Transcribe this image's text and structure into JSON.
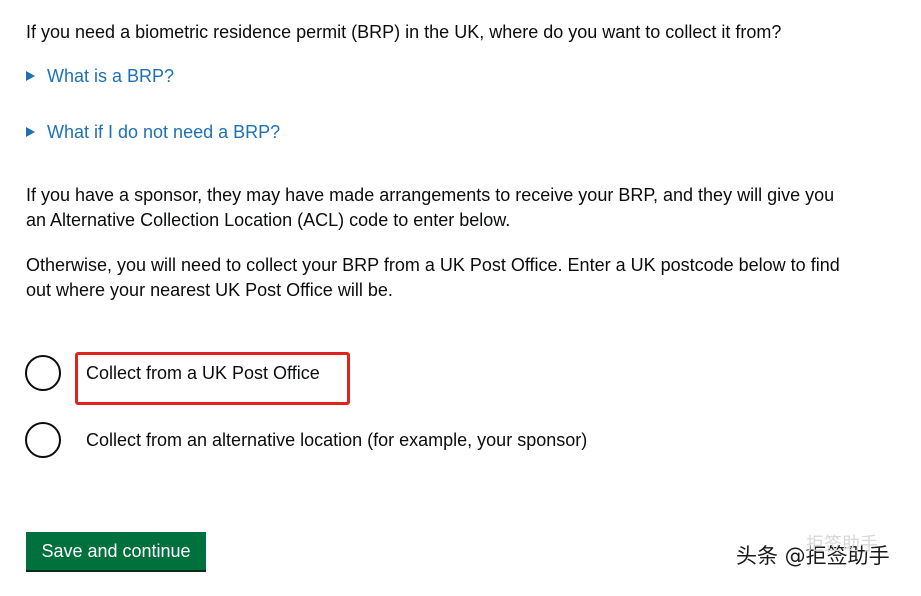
{
  "question": "If you need a biometric residence permit (BRP) in the UK, where do you want to collect it from?",
  "details": [
    {
      "summary": "What is a BRP?"
    },
    {
      "summary": "What if I do not need a BRP?"
    }
  ],
  "paragraphs": [
    "If you have a sponsor, they may have made arrangements to receive your BRP, and they will give you an Alternative Collection Location (ACL) code to enter below.",
    "Otherwise, you will need to collect your BRP from a UK Post Office. Enter a UK postcode below to find out where your nearest UK Post Office will be."
  ],
  "options": [
    {
      "label": "Collect from a UK Post Office",
      "selected": false
    },
    {
      "label": "Collect from an alternative location (for example, your sponsor)",
      "selected": false
    }
  ],
  "save_button": "Save and continue",
  "watermark": {
    "text": "头条 @拒签助手",
    "ghost_text": "拒签助手"
  },
  "colors": {
    "link": "#1d70b8",
    "button": "#00703c",
    "highlight": "#e0241c",
    "text": "#0b0c0c"
  }
}
